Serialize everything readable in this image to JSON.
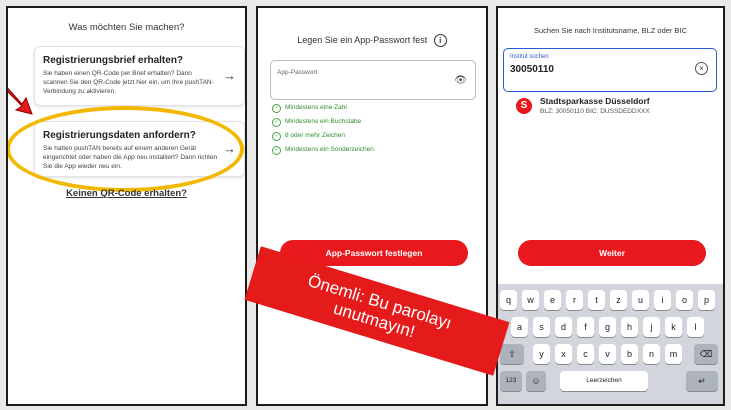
{
  "screen1": {
    "title": "Was möchten Sie machen?",
    "card1": {
      "title": "Registrierungsbrief erhalten?",
      "text": "Sie haben einen QR-Code per Brief erhalten? Dann scannen Sie den QR-Code jetzt hier ein, um Ihre pushTAN-Verbindung zu aktivieren."
    },
    "card2": {
      "title": "Registrierungsdaten anfordern?",
      "text": "Sie hatten pushTAN bereits auf einem anderen Gerät eingerichtet oder haben die App neu installiert? Dann richten Sie die App wieder neu ein."
    },
    "link": "Keinen QR-Code erhalten?",
    "arrow": "→"
  },
  "screen2": {
    "title": "Legen Sie ein App-Passwort fest",
    "info": "i",
    "field_placeholder": "App-Passwort",
    "eye": "👁",
    "rules": [
      "Mindestens eine Zahl",
      "Mindestens ein Buchstabe",
      "8 oder mehr Zeichen",
      "Mindestens ein Sonderzeichen"
    ],
    "check": "✓",
    "button": "App-Passwort festlegen"
  },
  "screen3": {
    "title": "Suchen Sie nach Institutsname, BLZ oder BIC",
    "search_label": "Institut suchen",
    "search_value": "30050110",
    "clear": "×",
    "result": {
      "logo": "S",
      "name": "Stadtsparkasse Düsseldorf",
      "meta": "BLZ: 30050110    BIC: DUSSDEDDXXX"
    },
    "button": "Weiter",
    "keyboard": {
      "row1": [
        "q",
        "w",
        "e",
        "r",
        "t",
        "z",
        "u",
        "i",
        "o",
        "p"
      ],
      "row2": [
        "a",
        "s",
        "d",
        "f",
        "g",
        "h",
        "j",
        "k",
        "l"
      ],
      "row3": [
        "y",
        "x",
        "c",
        "v",
        "b",
        "n",
        "m"
      ],
      "shift": "⇧",
      "backspace": "⌫",
      "numbers": "123",
      "emoji": "☺",
      "space": "Leerzeichen",
      "return": "↵"
    }
  },
  "banner": {
    "line1": "Önemli: Bu parolayı",
    "line2": "unutmayın!"
  },
  "colors": {
    "accent_red": "#e8191c",
    "highlight_yellow": "#f2b800",
    "link_blue": "#2a5bd7",
    "check_green": "#2f8f2f"
  }
}
